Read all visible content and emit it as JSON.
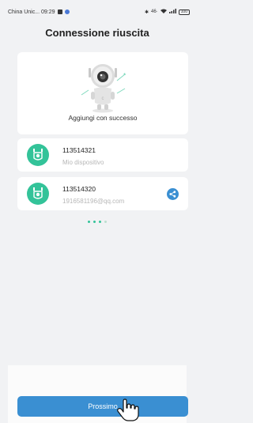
{
  "status_bar": {
    "carrier_time": "China Unic... 09:29",
    "right_text": "46· ",
    "battery": "100"
  },
  "header": {
    "title": "Connessione riuscita"
  },
  "success": {
    "message": "Aggiungi con successo",
    "illustration": "robot-camera-illustration"
  },
  "devices": [
    {
      "id": "113514321",
      "subtitle": "Mio dispositivo",
      "icon": "camera-icon",
      "shared": false
    },
    {
      "id": "113514320",
      "subtitle": "1916581196@qq.com",
      "icon": "camera-icon",
      "shared": true,
      "share_icon": "share-icon"
    }
  ],
  "pagination": {
    "total": 4,
    "active": [
      0,
      1,
      2
    ]
  },
  "footer": {
    "next_label": "Prossimo",
    "cursor_icon": "hand-pointer-icon"
  },
  "colors": {
    "accent": "#3a8fd2",
    "device_icon": "#33c399",
    "background": "#f1f2f4",
    "dot_active": "#33c399",
    "dot_inactive": "#bcdfcf"
  }
}
